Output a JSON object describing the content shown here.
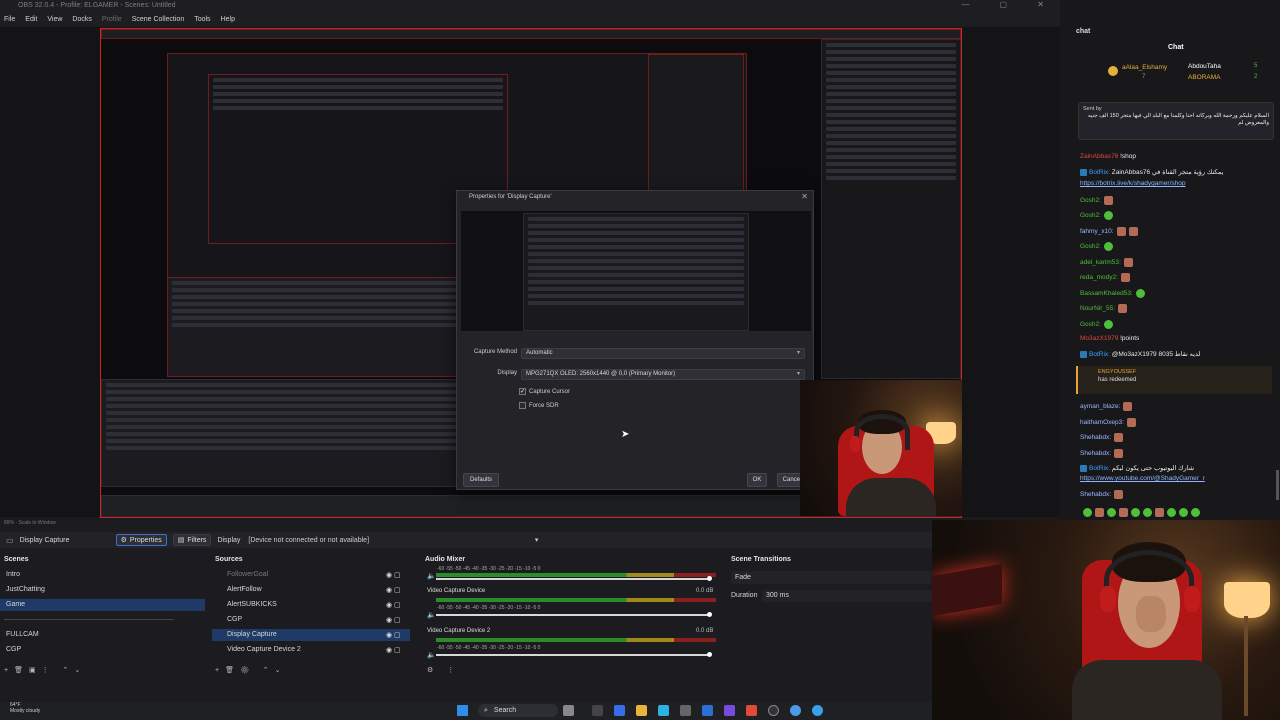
{
  "window": {
    "title": "OBS 32.0.4 - Profile: ELGAMER - Scenes: Untitled",
    "controls": "—  ▢  ✕"
  },
  "menu": [
    "File",
    "Edit",
    "View",
    "Docks",
    "Profile",
    "Scene Collection",
    "Tools",
    "Help"
  ],
  "dialog": {
    "title": "Properties for 'Display Capture'",
    "capture_method_label": "Capture Method",
    "capture_method_value": "Automatic",
    "display_label": "Display",
    "display_value": "MPG271QX OLED: 2560x1440 @ 0,0 (Primary Monitor)",
    "capture_cursor_label": "Capture Cursor",
    "capture_cursor_checked": true,
    "force_sdr_label": "Force SDR",
    "force_sdr_checked": false,
    "defaults_button": "Defaults",
    "ok_button": "OK",
    "cancel_button": "Cancel"
  },
  "chat": {
    "panel_label": "chat",
    "title": "Chat",
    "leaderboard": [
      {
        "name": "aAlaa_Elshamy",
        "count": "7"
      },
      {
        "name": "AbdouTaha",
        "count": "5"
      },
      {
        "name": "ABORAMA",
        "count": "2"
      }
    ],
    "pinned_sender": "Sent by",
    "pinned_text": "السلام عليكم ورحمة الله وبركاته احنا وكلمنا مع البلد الي فيها متجر 150 الف جنيه والمعروض لم",
    "messages": [
      {
        "user": "ZainAbbas76",
        "text": "!shop",
        "color": "#e0473f"
      },
      {
        "user": "BotRix:",
        "text": "ZainAbbas76 يمكنك رؤية متجر القناة في",
        "color": "#3aa3ff",
        "link": "https://botrix.live/k/shadygamer/shop"
      },
      {
        "user": "Gosh2:",
        "text": "",
        "color": "#4fbf3a"
      },
      {
        "user": "Gosh2:",
        "text": "",
        "color": "#4fbf3a"
      },
      {
        "user": "fahmy_x10:",
        "text": "",
        "color": "#9db8ff"
      },
      {
        "user": "Gosh2:",
        "text": "",
        "color": "#4fbf3a"
      },
      {
        "user": "adel_karim53:",
        "text": "",
        "color": "#4fbf3a"
      },
      {
        "user": "reda_mody2:",
        "text": "",
        "color": "#4fbf3a"
      },
      {
        "user": "BassamKhaled53:",
        "text": "",
        "color": "#4fbf3a"
      },
      {
        "user": "NourNir_55:",
        "text": "",
        "color": "#4fbf3a"
      },
      {
        "user": "Gosh2:",
        "text": "",
        "color": "#4fbf3a"
      },
      {
        "user": "Mo3azX1979",
        "text": "!points",
        "color": "#e0473f"
      },
      {
        "user": "BotRix:",
        "text": "@Mo3azX1979 8035 لديه نقاط",
        "color": "#3aa3ff"
      },
      {
        "user": "ENGYOUSSEF",
        "text": "has redeemed",
        "color": "#e8a33a"
      },
      {
        "user": "ayman_blaze:",
        "text": "",
        "color": "#9db8ff"
      },
      {
        "user": "haithamOxep3:",
        "text": "",
        "color": "#9db8ff"
      },
      {
        "user": "Shehabdx:",
        "text": "",
        "color": "#9db8ff"
      },
      {
        "user": "Shehabdx:",
        "text": "",
        "color": "#9db8ff"
      },
      {
        "user": "BotRix:",
        "text": "شارك اليوتيوب حتى يكون ليكم",
        "color": "#3aa3ff",
        "link": "https://www.youtube.com/@ShadyGamer_r"
      },
      {
        "user": "Shehabdx:",
        "text": "",
        "color": "#9db8ff"
      }
    ]
  },
  "source_toolbar": {
    "source_name": "Display Capture",
    "properties_label": "Properties",
    "filters_label": "Filters",
    "display_label": "Display",
    "display_value": "[Device not connected or not available]"
  },
  "status": {
    "zoom": "89%",
    "scale": "Scale to Window"
  },
  "scenes": {
    "title": "Scenes",
    "items": [
      "Intro",
      "JustChatting",
      "Game",
      "FULLCAM",
      "CGP"
    ],
    "selected": "Game"
  },
  "sources": {
    "title": "Sources",
    "items": [
      "FollowerGoal",
      "AlertFollow",
      "AlertSUBKICKS",
      "CGP",
      "Display Capture",
      "Video Capture Device 2"
    ],
    "selected": "Display Capture"
  },
  "audio_mixer": {
    "title": "Audio Mixer",
    "ticks": "-60  -55  -50  -45  -40  -35  -30  -25  -20  -15  -10  -5  0",
    "channels": [
      {
        "name": "",
        "db": "",
        "level": 0.98
      },
      {
        "name": "Video Capture Device",
        "db": "0.0 dB",
        "level": 0.98
      },
      {
        "name": "Video Capture Device 2",
        "db": "0.0 dB",
        "level": 0.98
      }
    ]
  },
  "scene_transitions": {
    "title": "Scene Transitions",
    "transition": "Fade",
    "duration_label": "Duration",
    "duration_value": "300 ms"
  },
  "taskbar": {
    "temp": "64°F",
    "weather": "Mostly cloudy",
    "search": "Search"
  },
  "colors": {
    "preview_border": "#d12323",
    "selection": "#1f3a66",
    "accent": "#3b6fd6"
  }
}
